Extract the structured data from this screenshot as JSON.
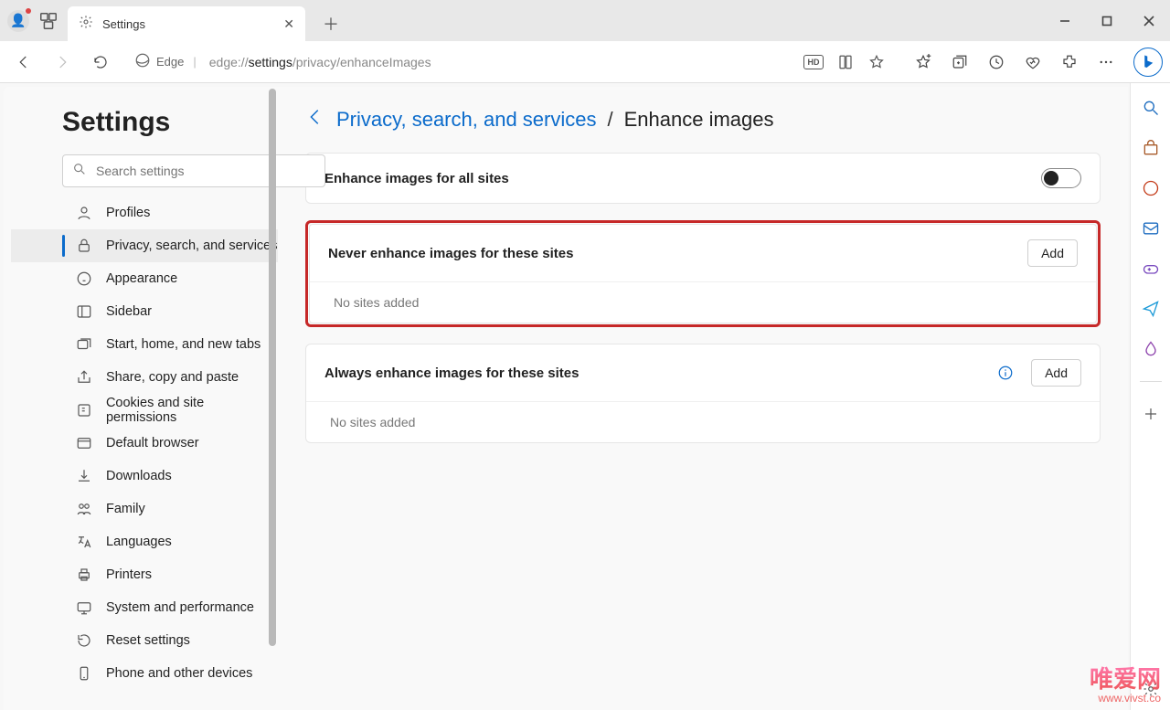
{
  "window": {
    "tab_title": "Settings",
    "url_prefix": "edge://",
    "url_bold": "settings",
    "url_suffix": "/privacy/enhanceImages",
    "edge_label": "Edge"
  },
  "settings": {
    "title": "Settings",
    "search_placeholder": "Search settings",
    "nav": {
      "profiles": "Profiles",
      "privacy": "Privacy, search, and services",
      "appearance": "Appearance",
      "sidebar": "Sidebar",
      "start": "Start, home, and new tabs",
      "share": "Share, copy and paste",
      "cookies": "Cookies and site permissions",
      "default_browser": "Default browser",
      "downloads": "Downloads",
      "family": "Family",
      "languages": "Languages",
      "printers": "Printers",
      "system": "System and performance",
      "reset": "Reset settings",
      "phone": "Phone and other devices"
    }
  },
  "content": {
    "breadcrumb_parent": "Privacy, search, and services",
    "breadcrumb_sep": "/",
    "breadcrumb_current": "Enhance images",
    "card_all_sites": "Enhance images for all sites",
    "card_never": {
      "title": "Never enhance images for these sites",
      "add": "Add",
      "empty": "No sites added"
    },
    "card_always": {
      "title": "Always enhance images for these sites",
      "add": "Add",
      "empty": "No sites added"
    }
  },
  "watermark": {
    "brand": "唯爱网",
    "url": "www.vivst.co"
  }
}
